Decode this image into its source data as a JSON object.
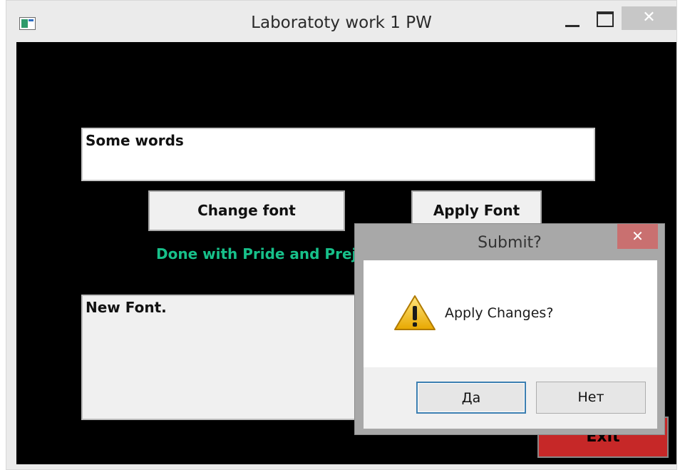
{
  "window": {
    "title": "Laboratoty work 1 PW",
    "close_glyph": "✕"
  },
  "form": {
    "input_text": "Some words",
    "change_font_label": "Change font",
    "apply_font_label": "Apply Font",
    "status_text": "Done with Pride and Prejudice",
    "output_text": "New Font.",
    "exit_label": "Exit"
  },
  "dialog": {
    "title": "Submit?",
    "message": "Apply Changes?",
    "yes_label": "Да",
    "no_label": "Нет",
    "close_glyph": "✕",
    "icon": "warning-icon"
  },
  "colors": {
    "client_background": "#000000",
    "status_text": "#17c08a",
    "exit_button": "#c62828",
    "dialog_close": "#c97070"
  }
}
